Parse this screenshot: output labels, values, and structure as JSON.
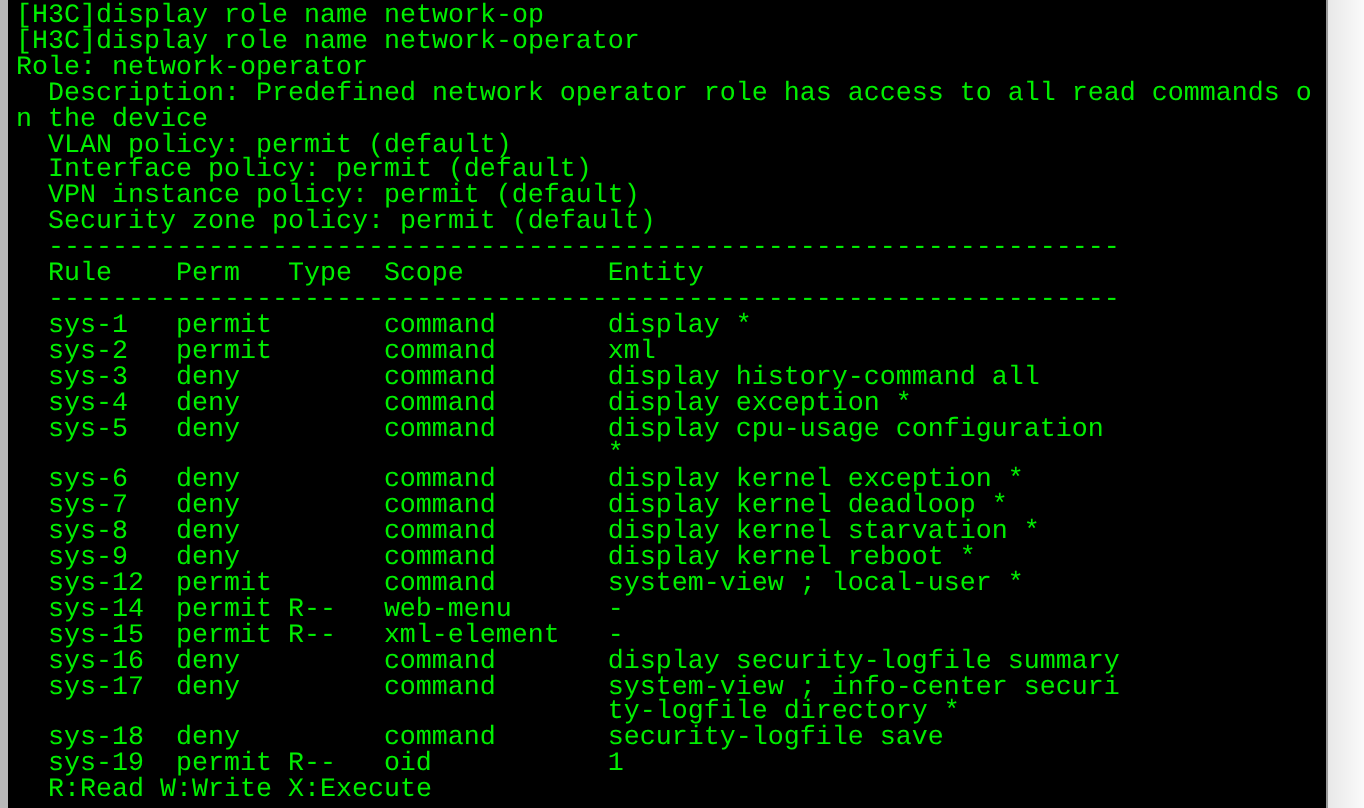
{
  "terminal": {
    "lines": [
      "[H3C]display role name network-op",
      "[H3C]display role name network-operator",
      "Role: network-operator"
    ],
    "description": "Description: Predefined network operator role has access to all read commands on the device",
    "policies": [
      "VLAN policy: permit (default)",
      "Interface policy: permit (default)",
      "VPN instance policy: permit (default)",
      "Security zone policy: permit (default)"
    ],
    "separator_top": "-------------------------------------------------------------------",
    "columns": [
      "Rule",
      "Perm",
      "Type",
      "Scope",
      "Entity"
    ],
    "separator_bottom": "-------------------------------------------------------------------",
    "rows": [
      {
        "rule": "sys-1",
        "perm": "permit",
        "scope": "command",
        "entity": "display *"
      },
      {
        "rule": "sys-2",
        "perm": "permit",
        "scope": "command",
        "entity": "xml"
      },
      {
        "rule": "sys-3",
        "perm": "deny",
        "scope": "command",
        "entity": "display history-command all"
      },
      {
        "rule": "sys-4",
        "perm": "deny",
        "scope": "command",
        "entity": "display exception *"
      },
      {
        "rule": "sys-5",
        "perm": "deny",
        "scope": "command",
        "entity": "display cpu-usage configuration *"
      },
      {
        "rule": "sys-6",
        "perm": "deny",
        "scope": "command",
        "entity": "display kernel exception *"
      },
      {
        "rule": "sys-7",
        "perm": "deny",
        "scope": "command",
        "entity": "display kernel deadloop *"
      },
      {
        "rule": "sys-8",
        "perm": "deny",
        "scope": "command",
        "entity": "display kernel starvation *"
      },
      {
        "rule": "sys-9",
        "perm": "deny",
        "scope": "command",
        "entity": "display kernel reboot *"
      },
      {
        "rule": "sys-12",
        "perm": "permit",
        "scope": "command",
        "entity": "system-view ; local-user *"
      },
      {
        "rule": "sys-14",
        "perm": "permit",
        "type": "R--",
        "scope": "web-menu",
        "entity": "-"
      },
      {
        "rule": "sys-15",
        "perm": "permit",
        "type": "R--",
        "scope": "xml-element",
        "entity": "-"
      },
      {
        "rule": "sys-16",
        "perm": "deny",
        "scope": "command",
        "entity": "display security-logfile summary"
      },
      {
        "rule": "sys-17",
        "perm": "deny",
        "scope": "command",
        "entity": "system-view ; info-center security-logfile directory *"
      },
      {
        "rule": "sys-18",
        "perm": "deny",
        "scope": "command",
        "entity": "security-logfile save"
      },
      {
        "rule": "sys-19",
        "perm": "permit",
        "type": "R--",
        "scope": "oid",
        "entity": "1"
      }
    ],
    "legend": "R:Read W:Write X:Execute"
  }
}
